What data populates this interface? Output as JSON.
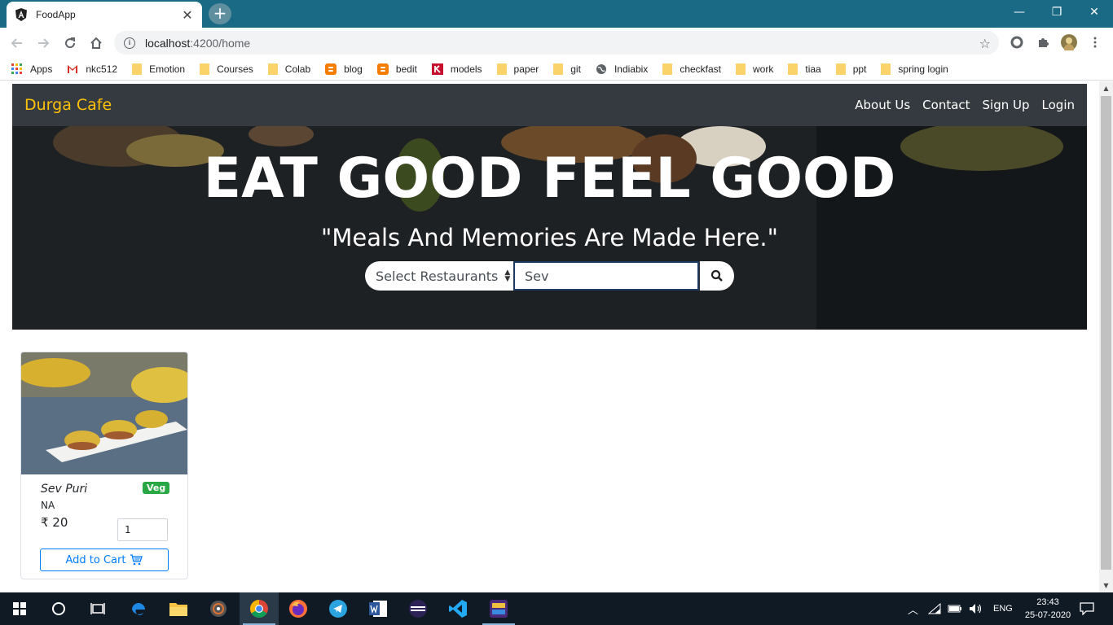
{
  "browser": {
    "tab_title": "FoodApp",
    "tab_close": "✕",
    "new_tab": "+",
    "url_host": "localhost",
    "url_path": ":4200/home",
    "window_controls": [
      "—",
      "❐",
      "✕"
    ]
  },
  "bookmarks": [
    {
      "label": "Apps",
      "icon": "apps-grid-icon"
    },
    {
      "label": "nkc512",
      "icon": "gmail-icon"
    },
    {
      "label": "Emotion",
      "icon": "folder-icon"
    },
    {
      "label": "Courses",
      "icon": "folder-icon"
    },
    {
      "label": "Colab",
      "icon": "folder-icon"
    },
    {
      "label": "blog",
      "icon": "blogger-icon"
    },
    {
      "label": "bedit",
      "icon": "blogger-icon"
    },
    {
      "label": "models",
      "icon": "k-icon"
    },
    {
      "label": "paper",
      "icon": "folder-icon"
    },
    {
      "label": "git",
      "icon": "folder-icon"
    },
    {
      "label": "Indiabix",
      "icon": "globe-icon"
    },
    {
      "label": "checkfast",
      "icon": "folder-icon"
    },
    {
      "label": "work",
      "icon": "folder-icon"
    },
    {
      "label": "tiaa",
      "icon": "folder-icon"
    },
    {
      "label": "ppt",
      "icon": "folder-icon"
    },
    {
      "label": "spring login",
      "icon": "folder-icon"
    }
  ],
  "navbar": {
    "brand": "Durga Cafe",
    "links": [
      "About Us",
      "Contact",
      "Sign Up",
      "Login"
    ]
  },
  "hero": {
    "title": "EAT GOOD FEEL GOOD",
    "subtitle": "\"Meals And Memories Are Made Here.\"",
    "select_label": "Select Restaurants",
    "search_value": "Sev"
  },
  "product": {
    "name": "Sev Puri",
    "badge": "Veg",
    "description": "NA",
    "price": "₹ 20",
    "quantity": "1",
    "add_to_cart": "Add to Cart"
  },
  "taskbar": {
    "language": "ENG",
    "time": "23:43",
    "date": "25-07-2020"
  },
  "colors": {
    "brand": "#ffc107",
    "navbar_bg": "#343a40",
    "veg_badge": "#28a745",
    "primary": "#007bff",
    "titlebar": "#1a6a86"
  }
}
